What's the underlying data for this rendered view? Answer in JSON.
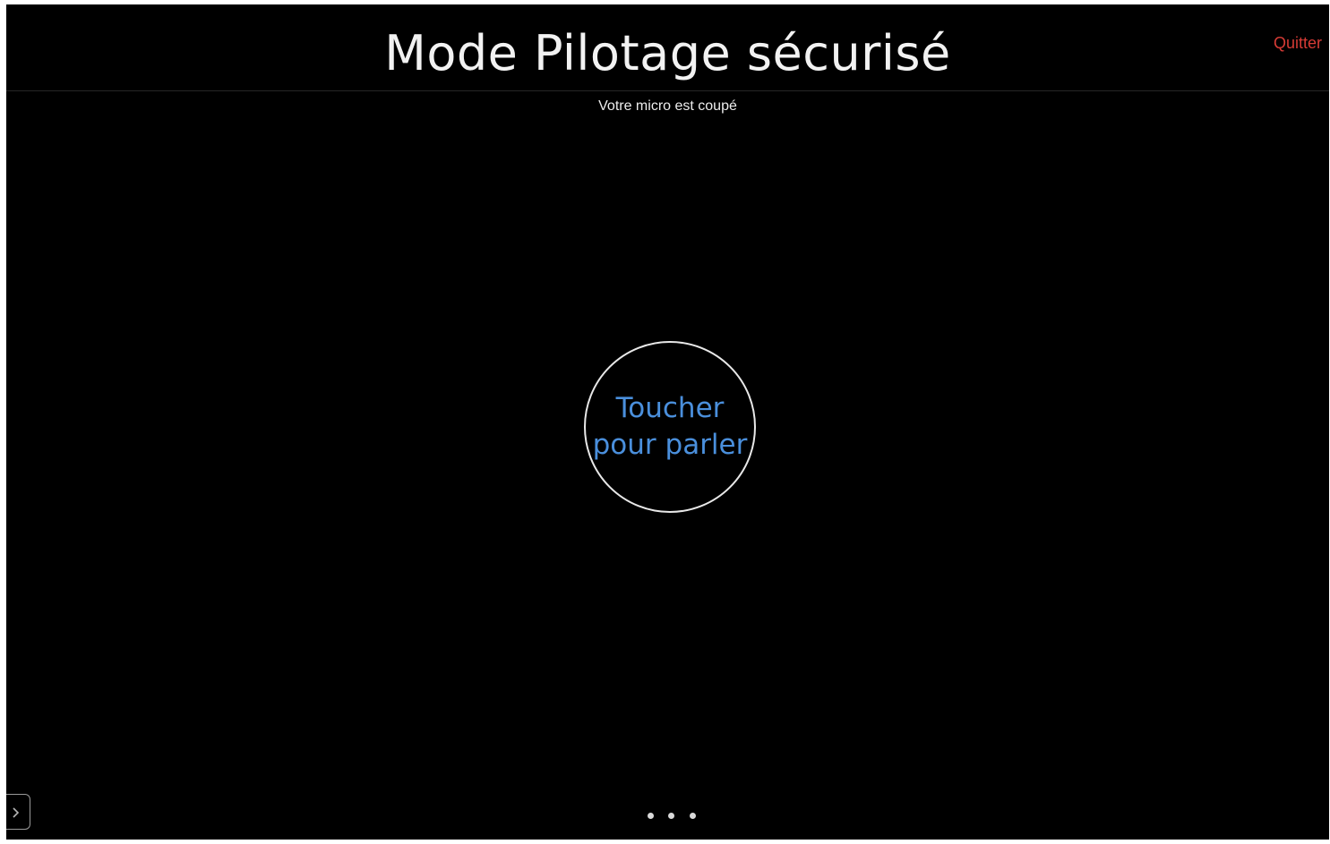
{
  "header": {
    "title": "Mode Pilotage sécurisé",
    "quit_label": "Quitter"
  },
  "status_text": "Votre micro est coupé",
  "talk_button": {
    "line1": "Toucher",
    "line2": "pour parler"
  },
  "side_toggle": {
    "icon": "chevron-right-icon"
  },
  "pagination": {
    "pages": 3
  },
  "colors": {
    "background": "#000000",
    "title": "#f2f2f2",
    "quit": "#d63b35",
    "talk_text": "#4a8fdc",
    "circle_border": "#e8e8e8"
  }
}
